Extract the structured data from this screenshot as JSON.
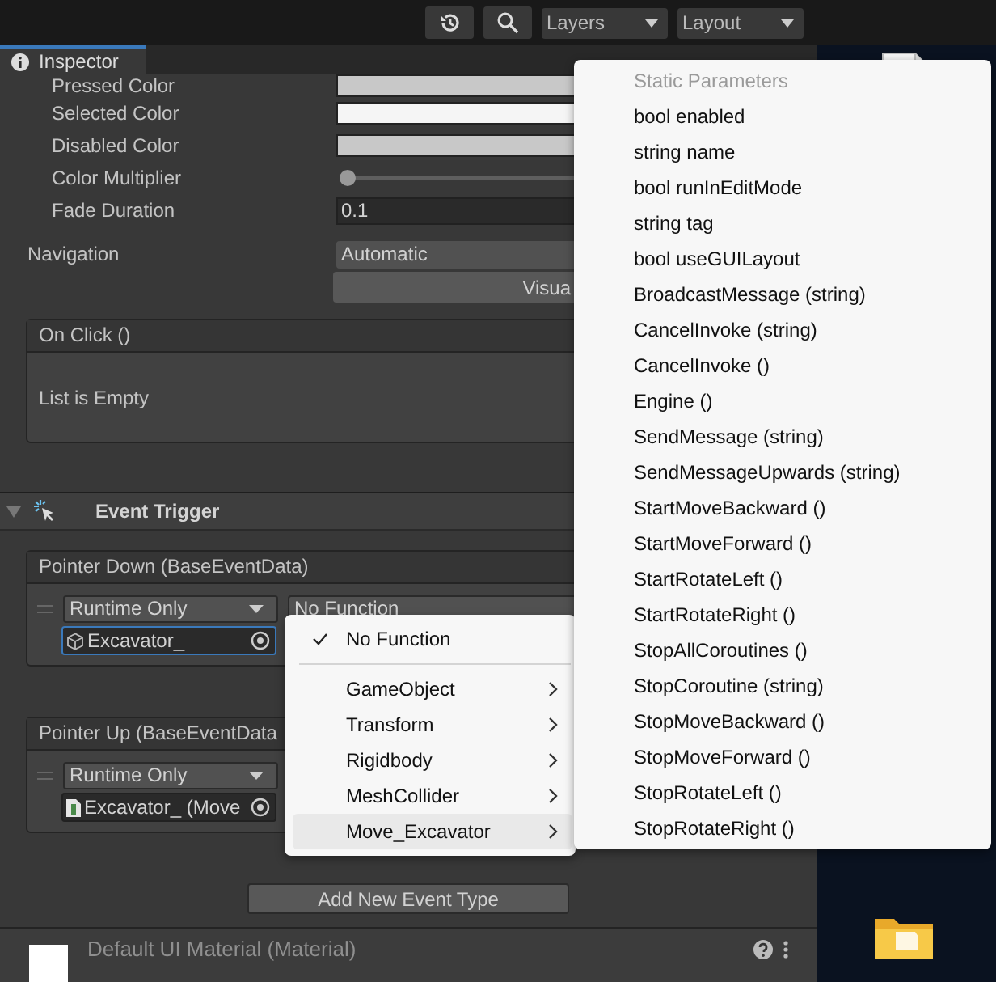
{
  "toolbar": {
    "tools": [
      {
        "kind": "history"
      },
      {
        "kind": "search"
      }
    ],
    "dropdowns": [
      "Layers",
      "Layout"
    ]
  },
  "inspector": {
    "tab": "Inspector",
    "properties": [
      {
        "label": "Pressed Color",
        "kind": "color",
        "color": "#c8c8c8"
      },
      {
        "label": "Selected Color",
        "kind": "color",
        "color": "#f5f5f5"
      },
      {
        "label": "Disabled Color",
        "kind": "color",
        "color": "#c8c8c8"
      },
      {
        "label": "Color Multiplier",
        "kind": "slider",
        "level": 0
      },
      {
        "label": "Fade Duration",
        "kind": "number",
        "value": "0.1"
      }
    ],
    "navigation": {
      "label": "Navigation",
      "value": "Automatic",
      "button": "Visua"
    },
    "on_click": {
      "title": "On Click ()",
      "empty_text": "List is Empty"
    },
    "event_trigger": {
      "title": "Event Trigger",
      "expanded": true,
      "events": [
        {
          "title": "Pointer Down (BaseEventData)",
          "mode": "Runtime Only",
          "function": "No Function",
          "object": "Excavator_",
          "kind": "gameobject",
          "focused": true
        },
        {
          "title": "Pointer Up (BaseEventData",
          "mode": "Runtime Only",
          "object": "Excavator_ (Move",
          "kind": "script",
          "focused": false
        }
      ],
      "add_button": "Add New Event Type"
    },
    "material": {
      "name": "Default UI Material (Material)"
    }
  },
  "function_menu": {
    "items": [
      {
        "label": "No Function",
        "kind": "option",
        "checked": true,
        "selected": false
      },
      {
        "label": "GameObject",
        "kind": "submenu",
        "checked": false,
        "selected": false
      },
      {
        "label": "Transform",
        "kind": "submenu",
        "checked": false,
        "selected": false
      },
      {
        "label": "Rigidbody",
        "kind": "submenu",
        "checked": false,
        "selected": false
      },
      {
        "label": "MeshCollider",
        "kind": "submenu",
        "checked": false,
        "selected": false
      },
      {
        "label": "Move_Excavator",
        "kind": "submenu",
        "checked": false,
        "selected": true
      }
    ]
  },
  "method_menu": {
    "items": [
      {
        "label": "Static Parameters",
        "kind": "header"
      },
      {
        "label": "bool enabled",
        "kind": "item"
      },
      {
        "label": "string name",
        "kind": "item"
      },
      {
        "label": "bool runInEditMode",
        "kind": "item"
      },
      {
        "label": "string tag",
        "kind": "item"
      },
      {
        "label": "bool useGUILayout",
        "kind": "item"
      },
      {
        "label": "BroadcastMessage (string)",
        "kind": "item"
      },
      {
        "label": "CancelInvoke (string)",
        "kind": "item"
      },
      {
        "label": "CancelInvoke ()",
        "kind": "item"
      },
      {
        "label": "Engine ()",
        "kind": "item"
      },
      {
        "label": "SendMessage (string)",
        "kind": "item"
      },
      {
        "label": "SendMessageUpwards (string)",
        "kind": "item"
      },
      {
        "label": "StartMoveBackward ()",
        "kind": "item"
      },
      {
        "label": "StartMoveForward ()",
        "kind": "item"
      },
      {
        "label": "StartRotateLeft ()",
        "kind": "item"
      },
      {
        "label": "StartRotateRight ()",
        "kind": "item"
      },
      {
        "label": "StopAllCoroutines ()",
        "kind": "item"
      },
      {
        "label": "StopCoroutine (string)",
        "kind": "item"
      },
      {
        "label": "StopMoveBackward ()",
        "kind": "item"
      },
      {
        "label": "StopMoveForward ()",
        "kind": "item"
      },
      {
        "label": "StopRotateLeft ()",
        "kind": "item"
      },
      {
        "label": "StopRotateRight ()",
        "kind": "item"
      }
    ]
  }
}
